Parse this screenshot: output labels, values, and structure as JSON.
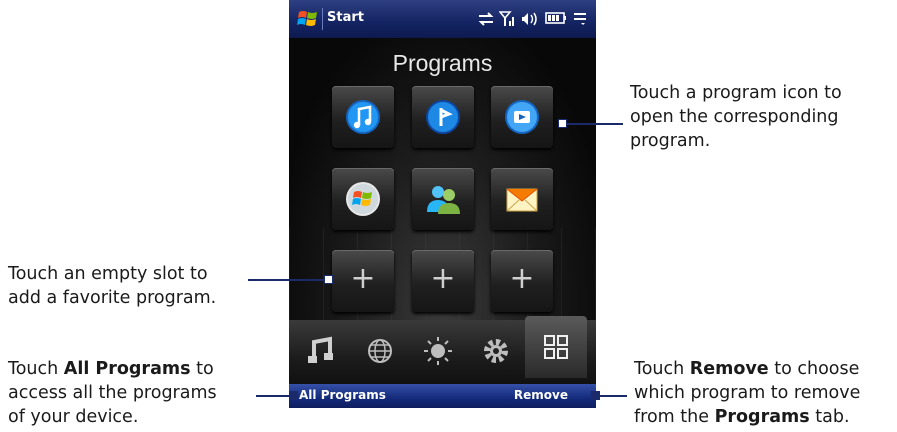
{
  "titlebar": {
    "title": "Start"
  },
  "screen": {
    "heading": "Programs",
    "program_icons": [
      "music-icon",
      "internet-explorer-icon",
      "media-player-icon",
      "windows-icon",
      "contacts-icon",
      "mail-icon"
    ],
    "empty_slot_label": "+",
    "tabs": [
      "music-tab-icon",
      "internet-tab-icon",
      "weather-tab-icon",
      "settings-tab-icon",
      "programs-tab-icon"
    ]
  },
  "softkeys": {
    "left": "All Programs",
    "right": "Remove"
  },
  "callouts": {
    "program_icon": {
      "line1": "Touch a program icon to",
      "line2": "open the corresponding",
      "line3": "program."
    },
    "empty_slot": {
      "line1": "Touch an empty slot to",
      "line2": "add a favorite program."
    },
    "all_programs": {
      "line1_prefix": "Touch ",
      "line1_bold": "All Programs",
      "line1_suffix": " to",
      "line2": "access all the programs",
      "line3": "of your device."
    },
    "remove": {
      "line1_prefix": "Touch ",
      "line1_bold": "Remove",
      "line1_suffix": " to choose",
      "line2": "which program to remove",
      "line3_prefix": "from the ",
      "line3_bold": "Programs",
      "line3_suffix": " tab."
    }
  },
  "colors": {
    "titlebar": "#142462",
    "softbar": "#142a7a",
    "callout_line": "#1b2a6b"
  }
}
